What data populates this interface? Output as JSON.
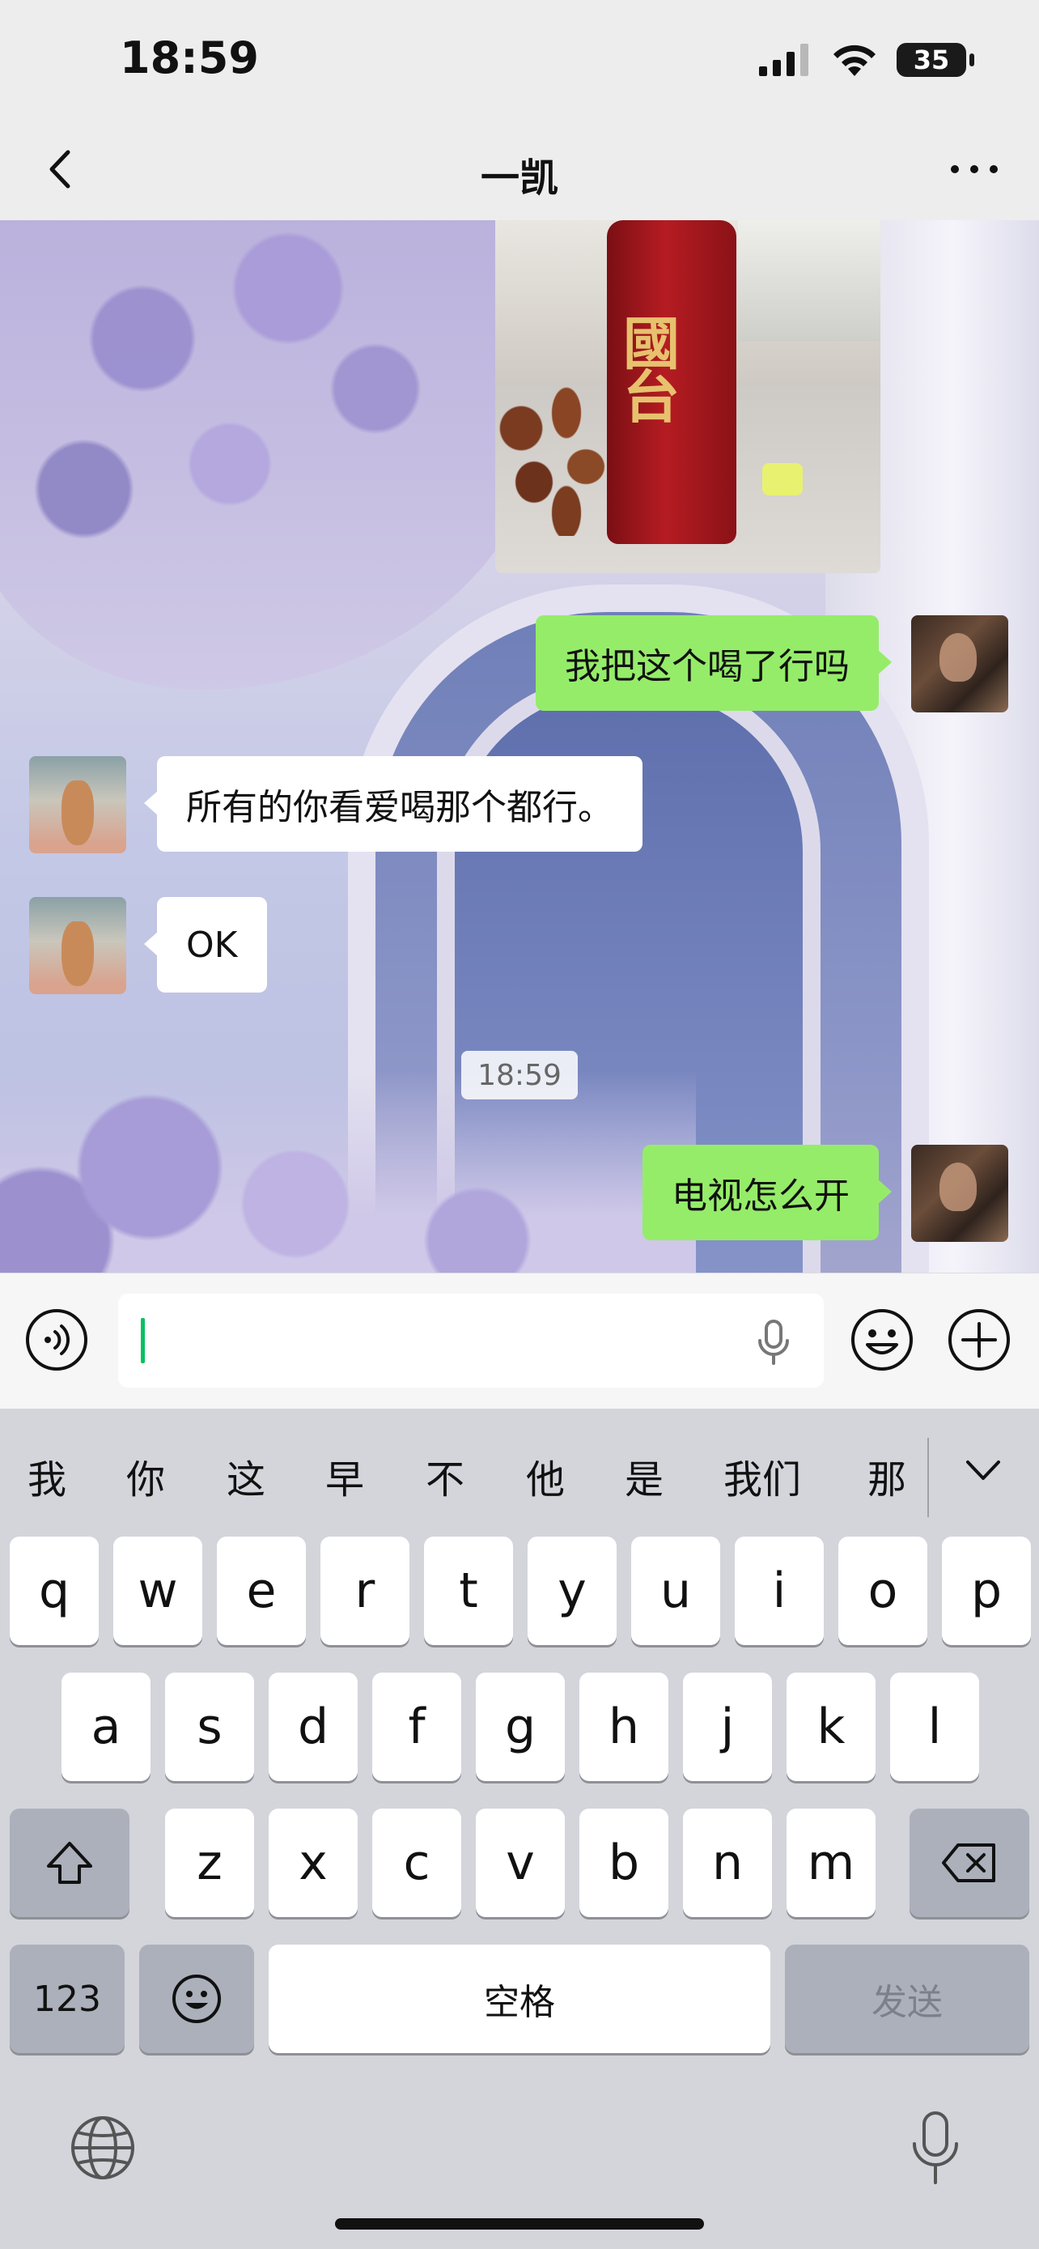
{
  "status_bar": {
    "time": "18:59",
    "battery": "35"
  },
  "nav": {
    "title": "一凯"
  },
  "messages": [
    {
      "from": "me",
      "type": "image",
      "image_text": "國台"
    },
    {
      "from": "me",
      "type": "text",
      "text": "我把这个喝了行吗"
    },
    {
      "from": "other",
      "type": "text",
      "text": "所有的你看爱喝那个都行。"
    },
    {
      "from": "other",
      "type": "text",
      "text": "OK"
    },
    {
      "type": "timestamp",
      "text": "18:59"
    },
    {
      "from": "me",
      "type": "text",
      "text": "电视怎么开"
    }
  ],
  "input": {
    "value": ""
  },
  "keyboard": {
    "candidates": [
      "我",
      "你",
      "这",
      "早",
      "不",
      "他",
      "是",
      "我们",
      "那"
    ],
    "row1": [
      "q",
      "w",
      "e",
      "r",
      "t",
      "y",
      "u",
      "i",
      "o",
      "p"
    ],
    "row2": [
      "a",
      "s",
      "d",
      "f",
      "g",
      "h",
      "j",
      "k",
      "l"
    ],
    "row3": [
      "z",
      "x",
      "c",
      "v",
      "b",
      "n",
      "m"
    ],
    "numbers_key": "123",
    "space_key": "空格",
    "send_key": "发送"
  },
  "colors": {
    "sent_bubble": "#95ec69",
    "received_bubble": "#ffffff",
    "cursor": "#07c160"
  }
}
